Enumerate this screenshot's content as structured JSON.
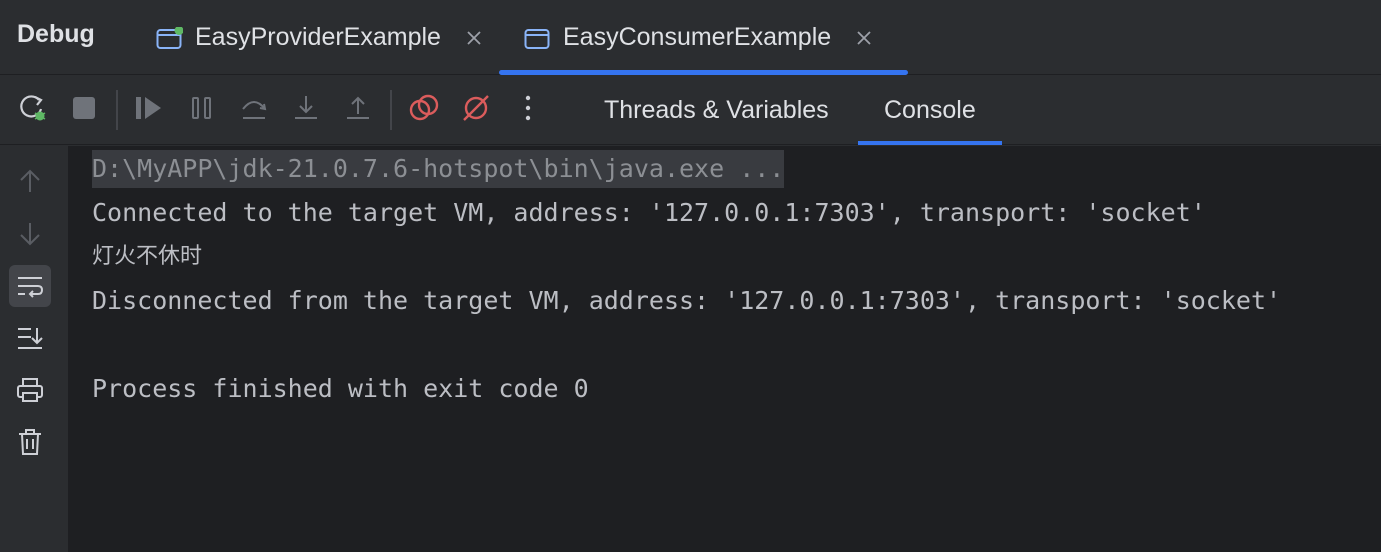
{
  "window": {
    "title": "Debug"
  },
  "tabs": [
    {
      "label": "EasyProviderExample",
      "icon": "run-config-icon",
      "status_dot_color": "#5fb865",
      "active": false
    },
    {
      "label": "EasyConsumerExample",
      "icon": "run-config-icon",
      "active": true
    }
  ],
  "toolbar": {
    "icons": [
      "rerun-icon",
      "stop-icon",
      "resume-icon",
      "pause-icon",
      "step-over-icon",
      "step-into-icon",
      "step-out-icon",
      "view-breakpoints-icon",
      "mute-breakpoints-icon",
      "more-icon"
    ],
    "subtabs": [
      {
        "label": "Threads & Variables",
        "active": false
      },
      {
        "label": "Console",
        "active": true
      }
    ]
  },
  "sidebar": {
    "icons": [
      "up-arrow-icon",
      "down-arrow-icon",
      "soft-wrap-icon",
      "scroll-to-end-icon",
      "print-icon",
      "trash-icon"
    ]
  },
  "console": {
    "lines": [
      "D:\\MyAPP\\jdk-21.0.7.6-hotspot\\bin\\java.exe ...",
      "Connected to the target VM, address: '127.0.0.1:7303', transport: 'socket'",
      "灯火不休时",
      "Disconnected from the target VM, address: '127.0.0.1:7303', transport: 'socket'",
      "",
      "Process finished with exit code 0"
    ]
  },
  "colors": {
    "accent": "#3574f0",
    "background": "#2b2d30",
    "console_bg": "#1e1f22",
    "stop_red": "#db5c5c"
  }
}
